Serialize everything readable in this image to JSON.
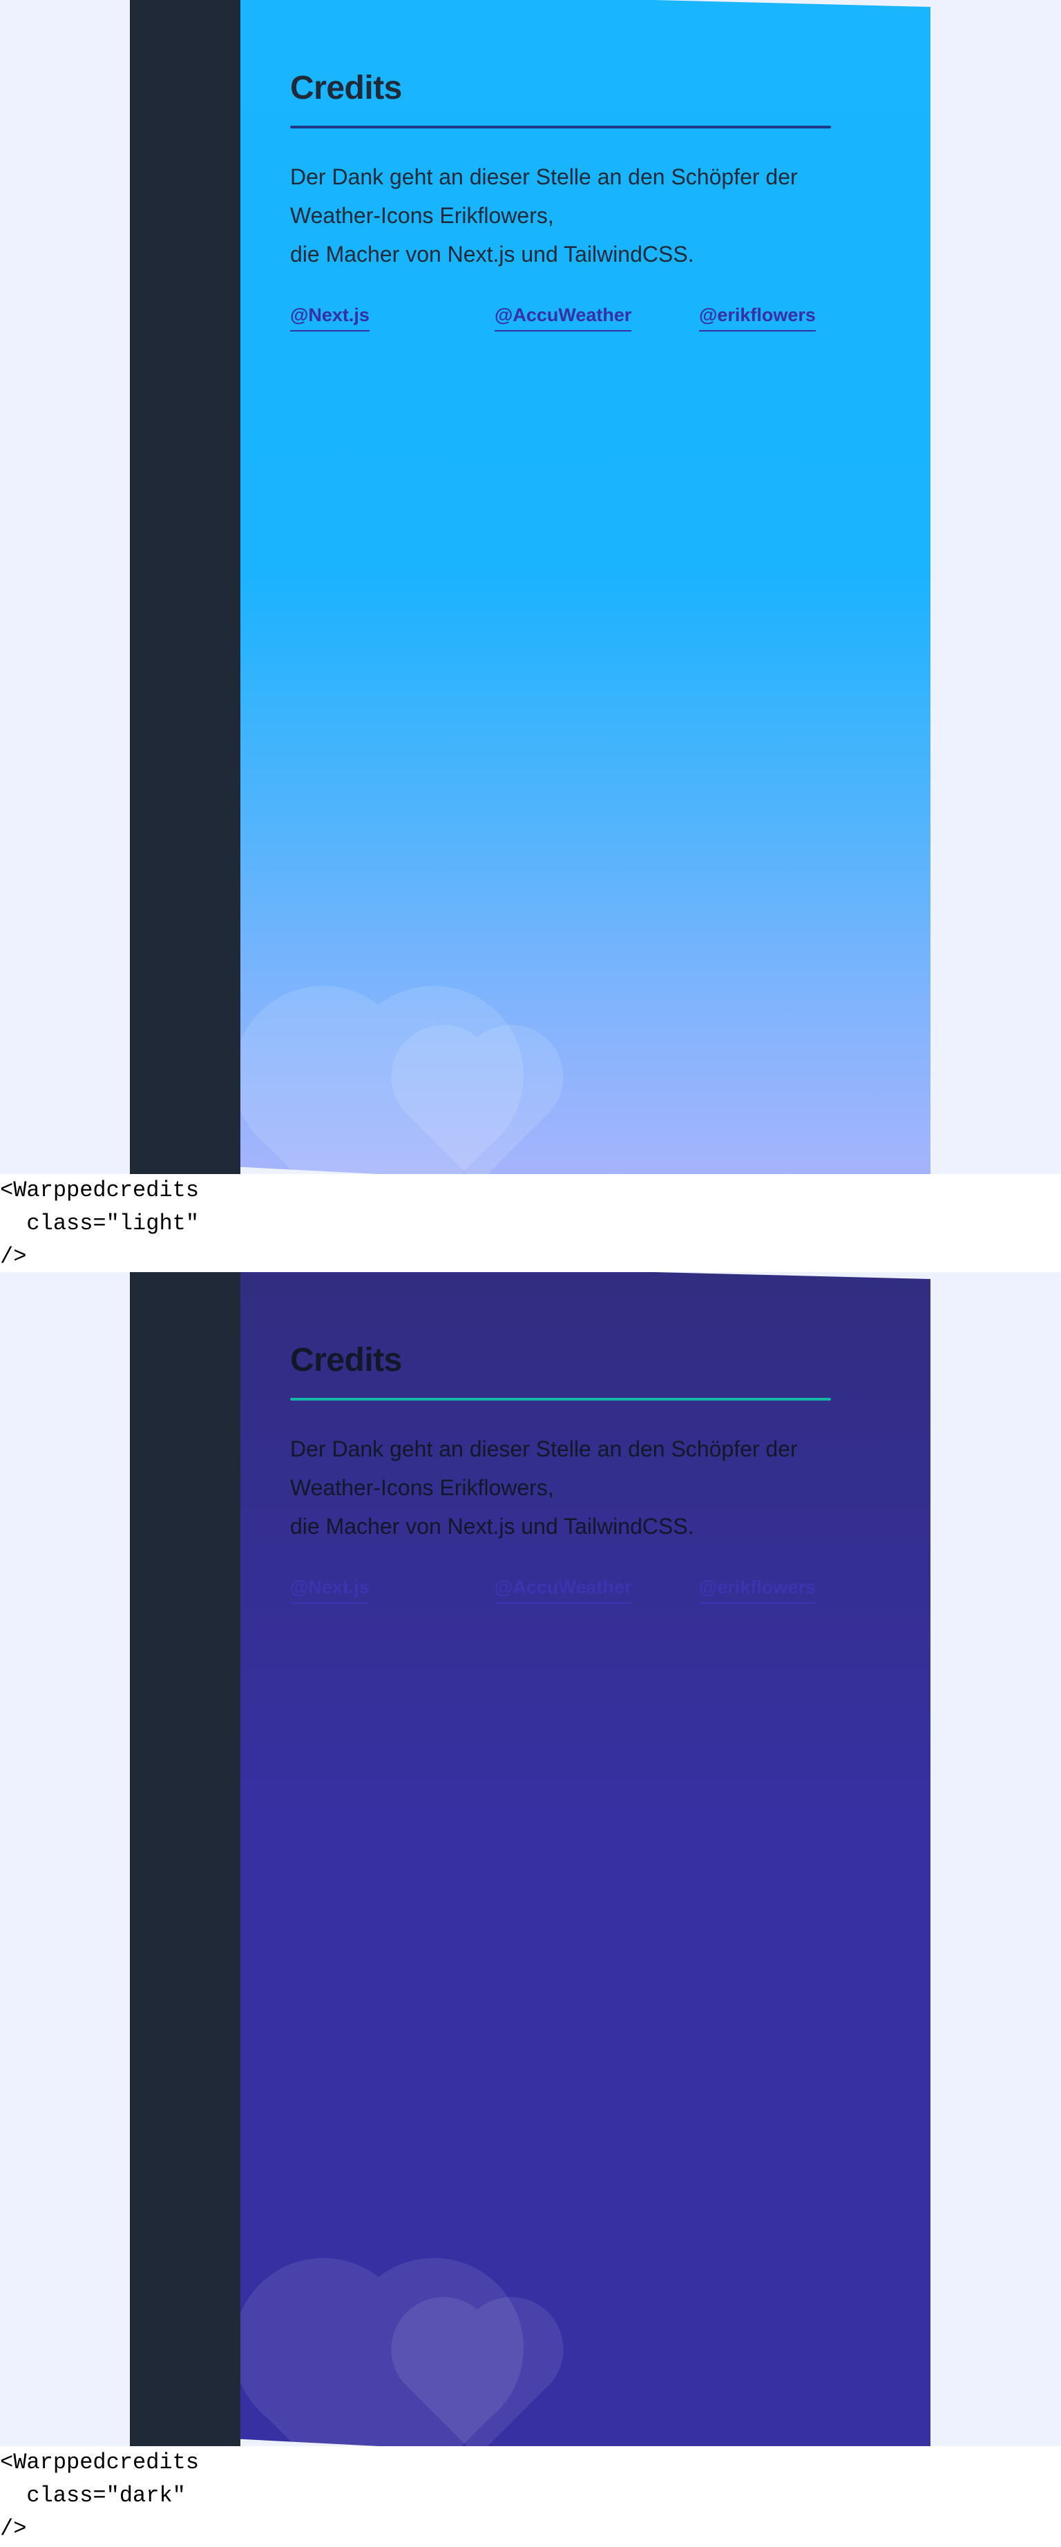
{
  "variants": [
    {
      "theme": "light",
      "card": {
        "title": "Credits",
        "text_lines": [
          "Der Dank geht an dieser Stelle an den Schöpfer der",
          "Weather-Icons Erikflowers,",
          "die Macher von Next.js und TailwindCSS."
        ],
        "links": [
          "@Next.js",
          "@AccuWeather",
          "@erikflowers"
        ],
        "decoration_icon": "heart-icon"
      },
      "code_lines": [
        "<Warppedcredits",
        "  class=\"light\"",
        "/>"
      ]
    },
    {
      "theme": "dark",
      "card": {
        "title": "Credits",
        "text_lines": [
          "Der Dank geht an dieser Stelle an den Schöpfer der",
          "Weather-Icons Erikflowers,",
          "die Macher von Next.js und TailwindCSS."
        ],
        "links": [
          "@Next.js",
          "@AccuWeather",
          "@erikflowers"
        ],
        "decoration_icon": "heart-icon"
      },
      "code_lines": [
        "<Warppedcredits",
        "  class=\"dark\"",
        "/>"
      ]
    }
  ],
  "colors": {
    "page_background": "#eef1fe",
    "sidebar": "#1f2937",
    "light_card_top": "#19b5fe",
    "light_card_bottom": "#a5b4fc",
    "dark_card": "#3730a3",
    "light_rule": "#1e3a8a",
    "dark_rule": "#14b8a6",
    "link": "#3730a3"
  }
}
